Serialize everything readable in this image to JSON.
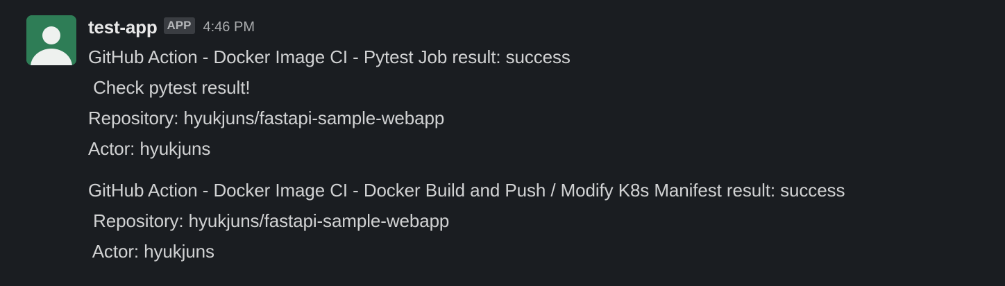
{
  "message": {
    "username": "test-app",
    "badge": "APP",
    "time": "4:46 PM",
    "avatar_icon": "default-user-avatar-icon",
    "avatar_color": "#2e7d56"
  },
  "block1": {
    "line1": "GitHub Action - Docker Image CI - Pytest Job result: success",
    "line2": " Check pytest result!",
    "line3": "Repository: hyukjuns/fastapi-sample-webapp",
    "line4": "Actor: hyukjuns"
  },
  "block2": {
    "line1": "GitHub Action - Docker Image CI - Docker Build and Push / Modify K8s Manifest result: success",
    "line2": " Repository: hyukjuns/fastapi-sample-webapp",
    "line3": " Actor: hyukjuns"
  }
}
